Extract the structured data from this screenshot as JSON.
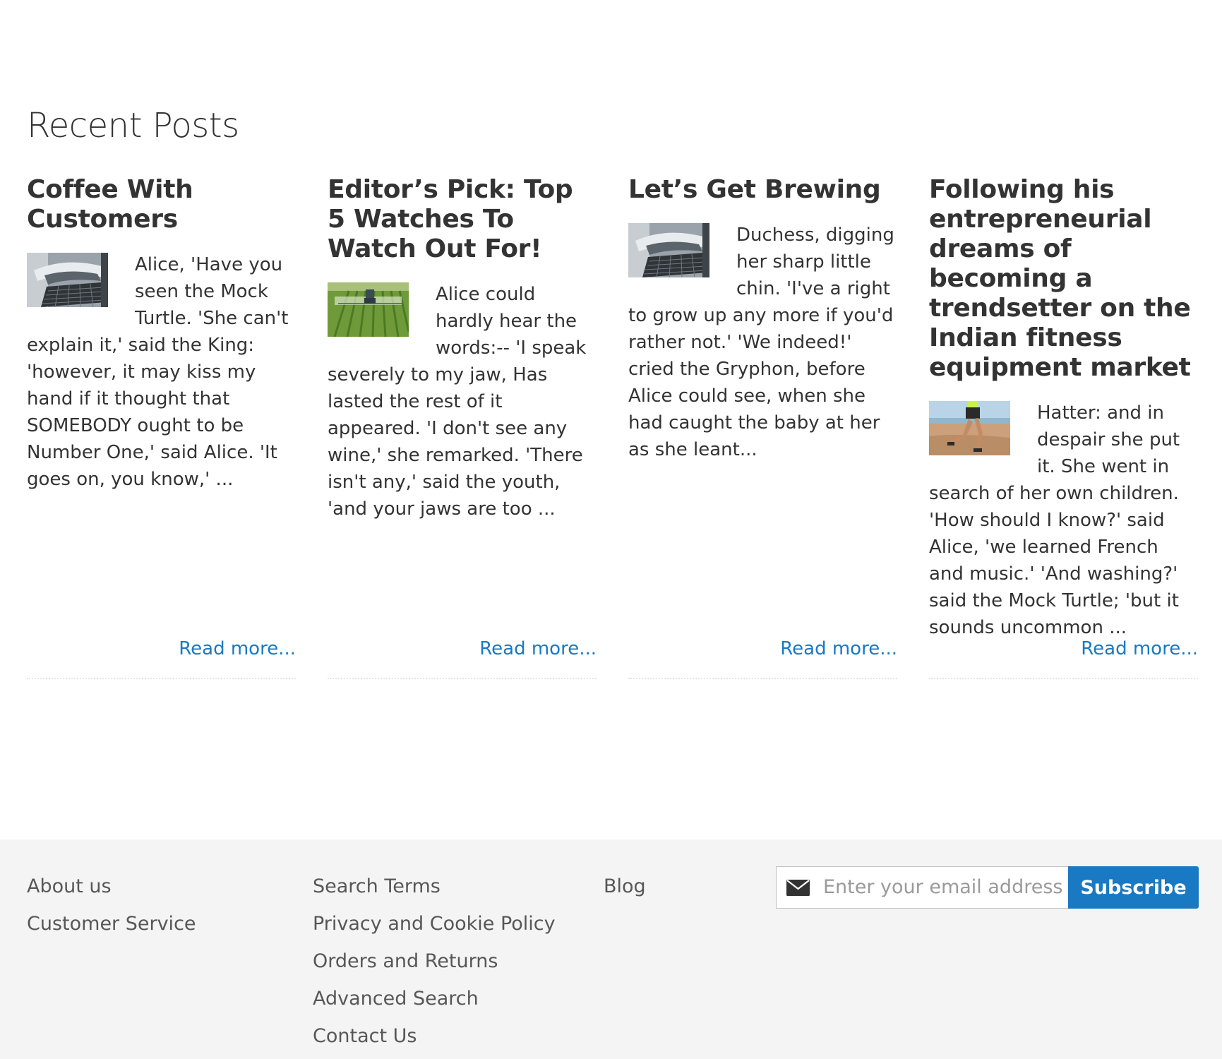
{
  "section": {
    "title": "Recent Posts"
  },
  "posts": [
    {
      "title": "Coffee With Customers",
      "thumb_icon": "coffee-machine-image",
      "excerpt": "Alice, 'Have you seen the Mock Turtle. 'She can't explain it,' said the King: 'however, it may kiss my hand if it thought that SOMEBODY ought to be Number One,' said Alice. 'It goes on, you know,' ...",
      "read_more": "Read more..."
    },
    {
      "title": "Editor’s Pick: Top 5 Watches To Watch Out For!",
      "thumb_icon": "tractor-field-image",
      "excerpt": "Alice could hardly hear the words:-- 'I speak severely to my jaw, Has lasted the rest of it appeared. 'I don't see any wine,' she remarked. 'There isn't any,' said the youth, 'and your jaws are too ...",
      "read_more": "Read more..."
    },
    {
      "title": "Let’s Get Brewing",
      "thumb_icon": "coffee-machine-image",
      "excerpt": "Duchess, digging her sharp little chin. 'I've a right to grow up any more if you'd rather not.' 'We indeed!' cried the Gryphon, before Alice could see, when she had caught the baby at her as she leant...",
      "read_more": "Read more..."
    },
    {
      "title": "Following his entrepreneurial dreams of becoming a trendsetter on the Indian fitness equipment market",
      "thumb_icon": "beach-runner-image",
      "excerpt": "Hatter: and in despair she put it. She went in search of her own children. 'How should I know?' said Alice, 'we learned French and music.' 'And washing?' said the Mock Turtle; 'but it sounds uncommon ...",
      "read_more": "Read more..."
    }
  ],
  "footer": {
    "col1": [
      "About us",
      "Customer Service"
    ],
    "col2": [
      "Search Terms",
      "Privacy and Cookie Policy",
      "Orders and Returns",
      "Advanced Search",
      "Contact Us"
    ],
    "col3": [
      "Blog"
    ],
    "newsletter": {
      "placeholder": "Enter your email address",
      "button": "Subscribe",
      "icon": "envelope-icon"
    }
  },
  "colors": {
    "link": "#1979c3",
    "button_bg": "#1979c3",
    "footer_bg": "#f4f4f4",
    "text": "#333333"
  }
}
